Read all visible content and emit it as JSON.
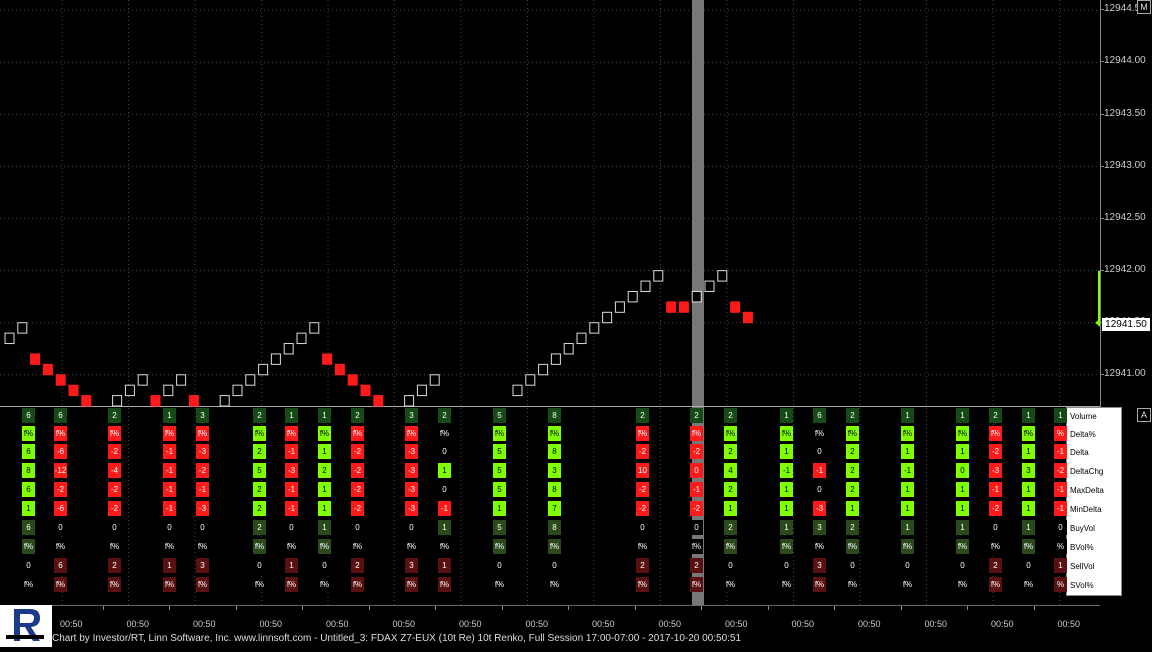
{
  "colors": {
    "up": "#7fff00",
    "down": "#ff1a1a",
    "background": "#000000",
    "grid": "#444444",
    "separator": "#777777",
    "cross": "#d9a300"
  },
  "price_axis": {
    "ticks": [
      "12944.50",
      "12944.00",
      "12943.50",
      "12943.00",
      "12942.50",
      "12942.00",
      "12941.50",
      "12941.00"
    ],
    "last_price": "12941.50"
  },
  "buttons": {
    "m_label": "M",
    "a_label": "A"
  },
  "legend": [
    "Volume",
    "Delta%",
    "Delta",
    "DeltaChg",
    "MaxDelta",
    "MinDelta",
    "BuyVol",
    "BVol%",
    "SellVol",
    "SVol%"
  ],
  "time_axis": {
    "labels": [
      "00:50",
      "00:50",
      "00:50",
      "00:50",
      "00:50",
      "00:50",
      "00:50",
      "00:50",
      "00:50",
      "00:50",
      "00:50",
      "00:50",
      "00:50",
      "00:50",
      "00:50",
      "00:50"
    ]
  },
  "footer": "Chart by Investor/RT, Linn Software, Inc. www.linnsoft.com - Untitled_3: FDAX Z7-EUX (10t Re) 10t Renko, Full Session 17:00-07:00 - 2017-10-20 00:50:51",
  "chart_data": {
    "type": "renko",
    "price_ylim": [
      12940.7,
      12944.6
    ],
    "bricks": [
      {
        "low": 12941.3,
        "high": 12941.4,
        "dir": "up"
      },
      {
        "low": 12941.4,
        "high": 12941.5,
        "dir": "up"
      },
      {
        "low": 12941.1,
        "high": 12941.2,
        "dir": "down"
      },
      {
        "low": 12941.0,
        "high": 12941.1,
        "dir": "down"
      },
      {
        "low": 12940.9,
        "high": 12941.0,
        "dir": "down"
      },
      {
        "low": 12940.8,
        "high": 12940.9,
        "dir": "down"
      },
      {
        "low": 12940.7,
        "high": 12940.8,
        "dir": "down"
      },
      {
        "low": 12940.7,
        "high": 12940.8,
        "dir": "up"
      },
      {
        "low": 12940.8,
        "high": 12940.9,
        "dir": "up"
      },
      {
        "low": 12940.9,
        "high": 12941.0,
        "dir": "up"
      },
      {
        "low": 12940.7,
        "high": 12940.8,
        "dir": "down"
      },
      {
        "low": 12940.8,
        "high": 12940.9,
        "dir": "up"
      },
      {
        "low": 12940.9,
        "high": 12941.0,
        "dir": "up"
      },
      {
        "low": 12940.7,
        "high": 12940.8,
        "dir": "down"
      },
      {
        "low": 12940.7,
        "high": 12940.8,
        "dir": "up"
      },
      {
        "low": 12940.8,
        "high": 12940.9,
        "dir": "up"
      },
      {
        "low": 12940.9,
        "high": 12941.0,
        "dir": "up"
      },
      {
        "low": 12941.0,
        "high": 12941.1,
        "dir": "up"
      },
      {
        "low": 12941.1,
        "high": 12941.2,
        "dir": "up"
      },
      {
        "low": 12941.2,
        "high": 12941.3,
        "dir": "up"
      },
      {
        "low": 12941.3,
        "high": 12941.4,
        "dir": "up"
      },
      {
        "low": 12941.4,
        "high": 12941.5,
        "dir": "up"
      },
      {
        "low": 12941.1,
        "high": 12941.2,
        "dir": "down"
      },
      {
        "low": 12941.0,
        "high": 12941.1,
        "dir": "down"
      },
      {
        "low": 12940.9,
        "high": 12941.0,
        "dir": "down"
      },
      {
        "low": 12940.8,
        "high": 12940.9,
        "dir": "down"
      },
      {
        "low": 12940.7,
        "high": 12940.8,
        "dir": "down"
      },
      {
        "low": 12940.7,
        "high": 12940.8,
        "dir": "up"
      },
      {
        "low": 12940.8,
        "high": 12940.9,
        "dir": "up"
      },
      {
        "low": 12940.9,
        "high": 12941.0,
        "dir": "up"
      },
      {
        "low": 12940.8,
        "high": 12940.9,
        "dir": "up"
      },
      {
        "low": 12940.9,
        "high": 12941.0,
        "dir": "up"
      },
      {
        "low": 12941.0,
        "high": 12941.1,
        "dir": "up"
      },
      {
        "low": 12941.1,
        "high": 12941.2,
        "dir": "up"
      },
      {
        "low": 12941.2,
        "high": 12941.3,
        "dir": "up"
      },
      {
        "low": 12941.3,
        "high": 12941.4,
        "dir": "up"
      },
      {
        "low": 12941.4,
        "high": 12941.5,
        "dir": "up"
      },
      {
        "low": 12941.5,
        "high": 12941.6,
        "dir": "up"
      },
      {
        "low": 12941.6,
        "high": 12941.7,
        "dir": "up"
      },
      {
        "low": 12941.7,
        "high": 12941.8,
        "dir": "up"
      },
      {
        "low": 12941.8,
        "high": 12941.9,
        "dir": "up"
      },
      {
        "low": 12941.9,
        "high": 12942.0,
        "dir": "up"
      },
      {
        "low": 12941.6,
        "high": 12941.7,
        "dir": "down"
      },
      {
        "low": 12941.6,
        "high": 12941.7,
        "dir": "down"
      },
      {
        "low": 12941.7,
        "high": 12941.8,
        "dir": "up"
      },
      {
        "low": 12941.8,
        "high": 12941.9,
        "dir": "up"
      },
      {
        "low": 12941.9,
        "high": 12942.0,
        "dir": "up"
      },
      {
        "low": 12941.6,
        "high": 12941.7,
        "dir": "down"
      },
      {
        "low": 12941.5,
        "high": 12941.6,
        "dir": "down"
      }
    ],
    "volume_bars": [
      {
        "vals": [
          "6",
          "f%",
          "6",
          "8",
          "6",
          "1",
          "6",
          "f%",
          "0",
          "f%"
        ],
        "dir": "up"
      },
      {
        "vals": [
          "6",
          "f%",
          "-6",
          "-12",
          "-2",
          "-6",
          "0",
          "f%",
          "6",
          "f%"
        ],
        "dir": "down"
      },
      {
        "vals": [
          "2",
          "f%",
          "-2",
          "-4",
          "-2",
          "-2",
          "0",
          "f%",
          "2",
          "f%"
        ],
        "dir": "down"
      },
      {
        "vals": [
          "1",
          "f%",
          "-1",
          "-1",
          "-1",
          "-1",
          "0",
          "f%",
          "1",
          "f%"
        ],
        "dir": "down"
      },
      {
        "vals": [
          "3",
          "f%",
          "-3",
          "-2",
          "-1",
          "-3",
          "0",
          "f%",
          "3",
          "f%"
        ],
        "dir": "down"
      },
      {
        "vals": [
          "2",
          "f%",
          "2",
          "5",
          "2",
          "2",
          "2",
          "f%",
          "0",
          "f%"
        ],
        "dir": "up"
      },
      {
        "vals": [
          "1",
          "f%",
          "-1",
          "-3",
          "-1",
          "-1",
          "0",
          "f%",
          "1",
          "f%"
        ],
        "dir": "down"
      },
      {
        "vals": [
          "1",
          "f%",
          "1",
          "2",
          "1",
          "1",
          "1",
          "f%",
          "0",
          "f%"
        ],
        "dir": "up"
      },
      {
        "vals": [
          "2",
          "f%",
          "-2",
          "-2",
          "-2",
          "-2",
          "0",
          "f%",
          "2",
          "f%"
        ],
        "dir": "down"
      },
      {
        "vals": [
          "3",
          "f%",
          "-3",
          "-3",
          "-3",
          "-3",
          "0",
          "f%",
          "3",
          "f%"
        ],
        "dir": "down"
      },
      {
        "vals": [
          "2",
          "f%",
          "0",
          "1",
          "0",
          "-1",
          "1",
          "f%",
          "1",
          "f%"
        ],
        "dir": "mix"
      },
      {
        "vals": [
          "5",
          "f%",
          "5",
          "5",
          "5",
          "1",
          "5",
          "f%",
          "0",
          "f%"
        ],
        "dir": "up"
      },
      {
        "vals": [
          "8",
          "f%",
          "8",
          "3",
          "8",
          "7",
          "8",
          "f%",
          "0",
          "f%"
        ],
        "dir": "up"
      },
      {
        "vals": [
          "2",
          "f%",
          "-2",
          "10",
          "-2",
          "-2",
          "0",
          "f%",
          "2",
          "f%"
        ],
        "dir": "down"
      },
      {
        "vals": [
          "2",
          "f%",
          "-2",
          "0",
          "-1",
          "-2",
          "0",
          "f%",
          "2",
          "f%"
        ],
        "dir": "down"
      },
      {
        "vals": [
          "2",
          "f%",
          "2",
          "4",
          "2",
          "1",
          "2",
          "f%",
          "0",
          "f%"
        ],
        "dir": "up"
      },
      {
        "vals": [
          "1",
          "f%",
          "1",
          "-1",
          "1",
          "1",
          "1",
          "f%",
          "0",
          "f%"
        ],
        "dir": "up"
      },
      {
        "vals": [
          "6",
          "f%",
          "0",
          "-1",
          "0",
          "-3",
          "3",
          "f%",
          "3",
          "f%"
        ],
        "dir": "mix"
      },
      {
        "vals": [
          "2",
          "f%",
          "2",
          "2",
          "2",
          "1",
          "2",
          "f%",
          "0",
          "f%"
        ],
        "dir": "up"
      },
      {
        "vals": [
          "1",
          "f%",
          "1",
          "-1",
          "1",
          "1",
          "1",
          "f%",
          "0",
          "f%"
        ],
        "dir": "up"
      },
      {
        "vals": [
          "1",
          "f%",
          "1",
          "0",
          "1",
          "1",
          "1",
          "f%",
          "0",
          "f%"
        ],
        "dir": "up"
      },
      {
        "vals": [
          "2",
          "f%",
          "-2",
          "-3",
          "-1",
          "-2",
          "0",
          "f%",
          "2",
          "f%"
        ],
        "dir": "down"
      },
      {
        "vals": [
          "1",
          "f%",
          "1",
          "3",
          "1",
          "1",
          "1",
          "f%",
          "0",
          "f%"
        ],
        "dir": "up"
      },
      {
        "vals": [
          "1",
          "%",
          "-1",
          "-2",
          "-1",
          "-1",
          "0",
          "%",
          "1",
          "%"
        ],
        "dir": "down"
      }
    ]
  }
}
